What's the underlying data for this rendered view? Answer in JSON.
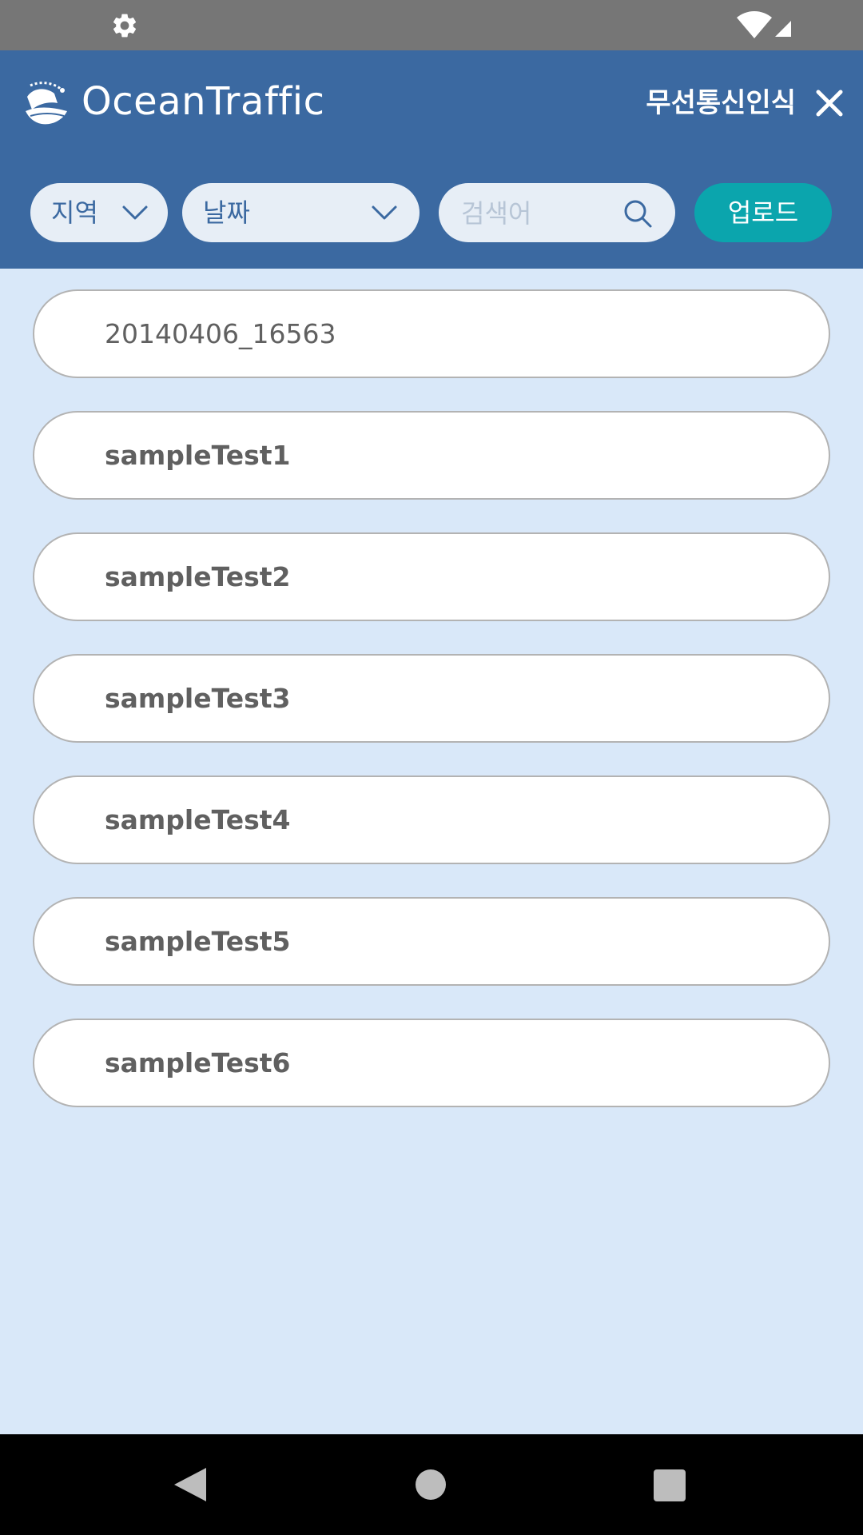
{
  "status_bar": {
    "icons": [
      "gear-icon",
      "wifi-icon",
      "signal-icon"
    ]
  },
  "header": {
    "app_title": "OceanTraffic",
    "action_label": "무선통신인식",
    "close_icon": "close-icon",
    "colors": {
      "background": "#3b69a1",
      "text": "#ffffff"
    }
  },
  "filters": {
    "region": {
      "label": "지역",
      "icon": "chevron-down-icon"
    },
    "date": {
      "label": "날짜",
      "icon": "chevron-down-icon"
    },
    "search": {
      "placeholder": "검색어",
      "value": "",
      "icon": "search-icon"
    },
    "upload_label": "업로드",
    "upload_color": "#0ba5ad"
  },
  "list": {
    "items": [
      {
        "label": "20140406_16563"
      },
      {
        "label": "sampleTest1"
      },
      {
        "label": "sampleTest2"
      },
      {
        "label": "sampleTest3"
      },
      {
        "label": "sampleTest4"
      },
      {
        "label": "sampleTest5"
      },
      {
        "label": "sampleTest6"
      }
    ]
  },
  "nav_bar": {
    "icons": [
      "back-icon",
      "home-icon",
      "recents-icon"
    ]
  }
}
